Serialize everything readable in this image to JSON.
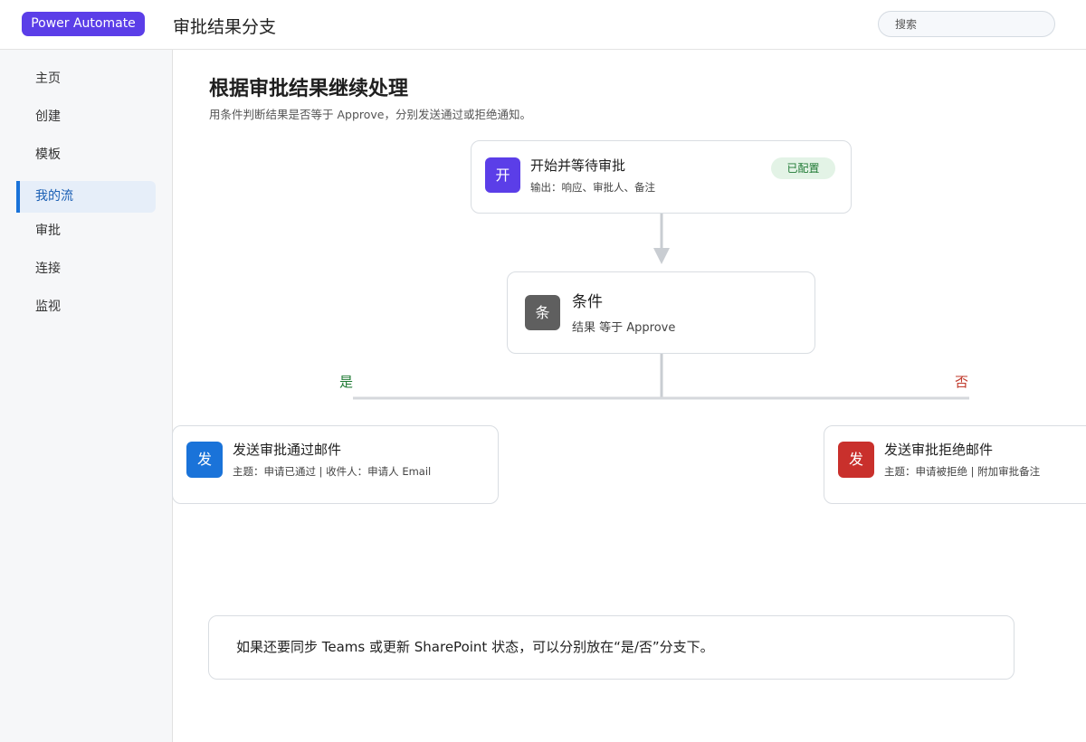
{
  "header": {
    "brand": "Power Automate",
    "title": "审批结果分支",
    "search_placeholder": "搜索"
  },
  "sidebar": {
    "items": [
      {
        "label": "主页"
      },
      {
        "label": "创建"
      },
      {
        "label": "模板"
      },
      {
        "label": "我的流",
        "active": true
      },
      {
        "label": "审批"
      },
      {
        "label": "连接"
      },
      {
        "label": "监视"
      }
    ]
  },
  "main": {
    "title": "根据审批结果继续处理",
    "subtitle": "用条件判断结果是否等于 Approve，分别发送通过或拒绝通知。"
  },
  "flow": {
    "trigger": {
      "icon_char": "开",
      "icon_color": "#5b3ee8",
      "title": "开始并等待审批",
      "desc": "输出：响应、审批人、备注",
      "status": "已配置"
    },
    "condition": {
      "icon_char": "条",
      "icon_color": "#5f5f5f",
      "title": "条件",
      "desc": "结果 等于 Approve"
    },
    "branch_yes_label": "是",
    "branch_no_label": "否",
    "yes_action": {
      "icon_char": "发",
      "icon_color": "#1a73d9",
      "title": "发送审批通过邮件",
      "desc": "主题：申请已通过 | 收件人：申请人 Email"
    },
    "no_action": {
      "icon_char": "发",
      "icon_color": "#c9302c",
      "title": "发送审批拒绝邮件",
      "desc": "主题：申请被拒绝 | 附加审批备注"
    }
  },
  "note": {
    "text": "如果还要同步 Teams 或更新 SharePoint 状态，可以分别放在“是/否”分支下。"
  },
  "colors": {
    "brand": "#5b3ee8",
    "active_nav": "#1a73d9",
    "yes": "#1f7a34",
    "no": "#c0392b"
  }
}
